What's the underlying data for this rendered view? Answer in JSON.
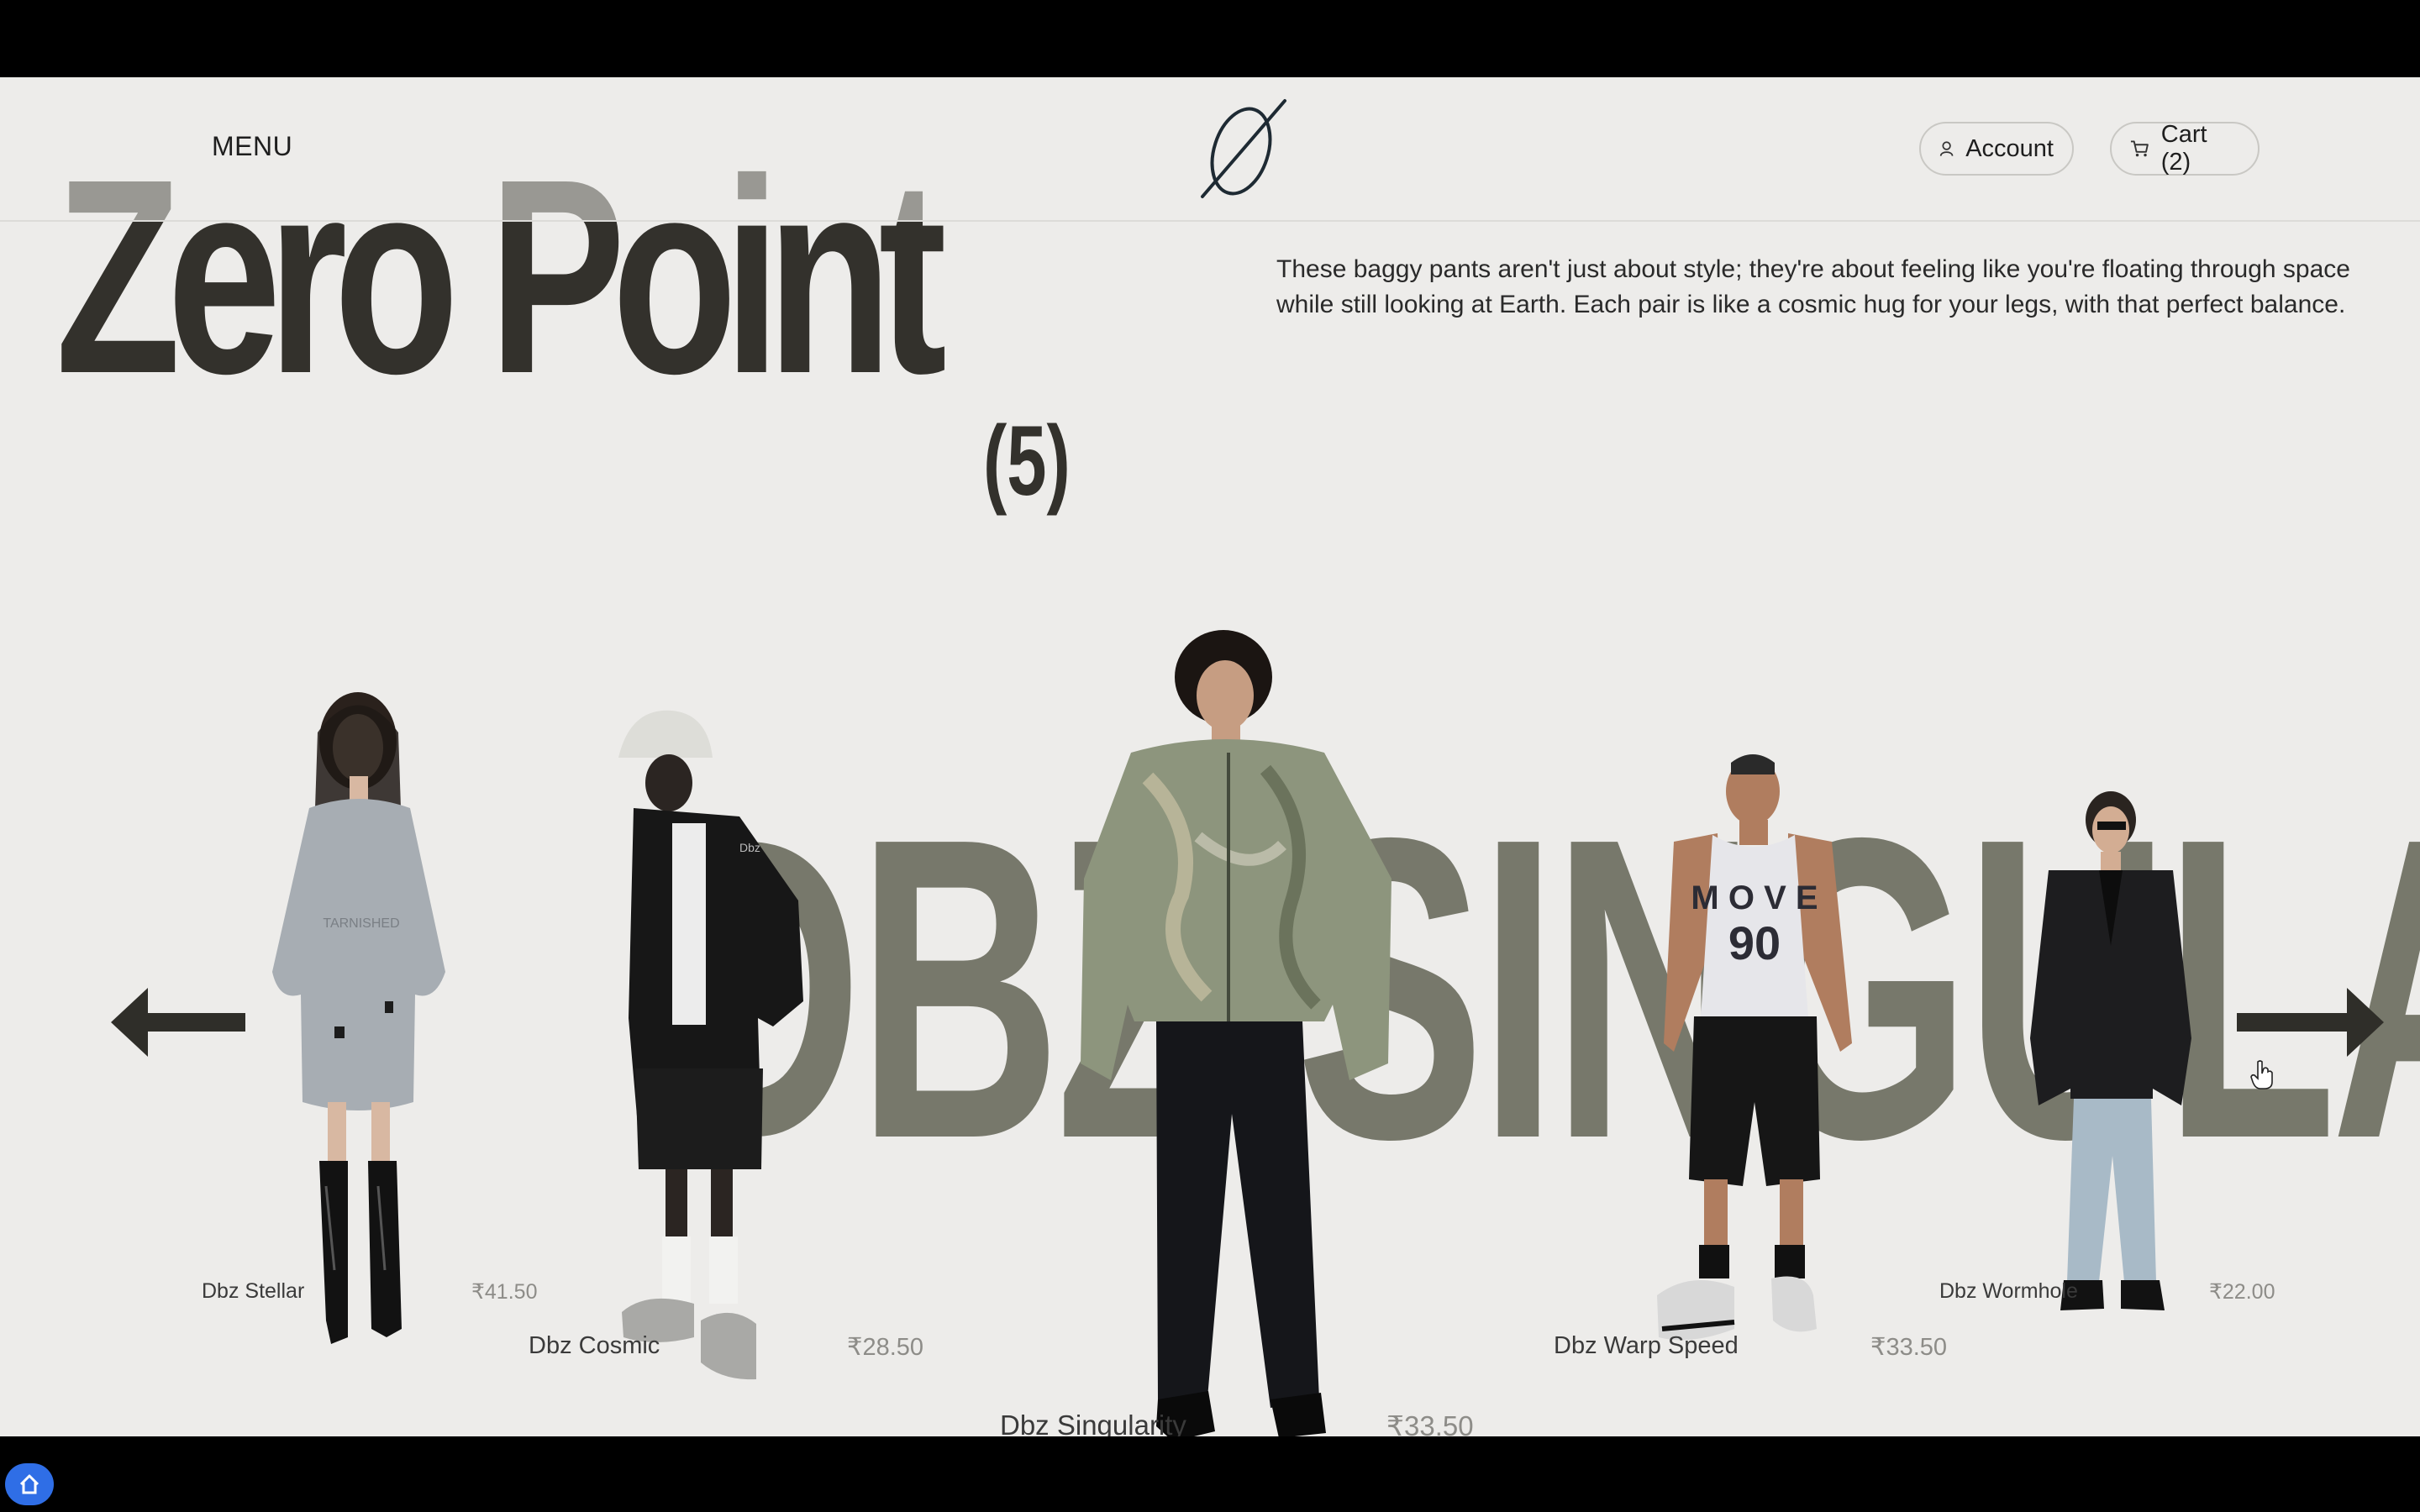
{
  "header": {
    "menu_label": "MENU",
    "logo_icon": "zero-point-logo-icon",
    "account_label": "Account",
    "cart_label": "Cart (2)"
  },
  "hero": {
    "title": "Zero Point",
    "count": "(5)",
    "description": "These baggy pants aren't just about style; they're about feeling like you're floating through space while still looking at Earth. Each pair is like a cosmic hug for your legs, with that perfect balance."
  },
  "carousel": {
    "backdrop_word": "DBZ SINGULARITY",
    "prev_icon": "arrow-left-icon",
    "next_icon": "arrow-right-icon",
    "products": [
      {
        "name": "Dbz Stellar",
        "price": "₹41.50"
      },
      {
        "name": "Dbz Cosmic",
        "price": "₹28.50"
      },
      {
        "name": "Dbz Singularity",
        "price": "₹33.50"
      },
      {
        "name": "Dbz Warp Speed",
        "price": "₹33.50"
      },
      {
        "name": "Dbz Wormhole",
        "price": "₹22.00"
      }
    ]
  },
  "colors": {
    "page_bg": "#edecea",
    "title": "#33312c",
    "backdrop_word": "#77786b",
    "fab": "#2f6ee6"
  }
}
